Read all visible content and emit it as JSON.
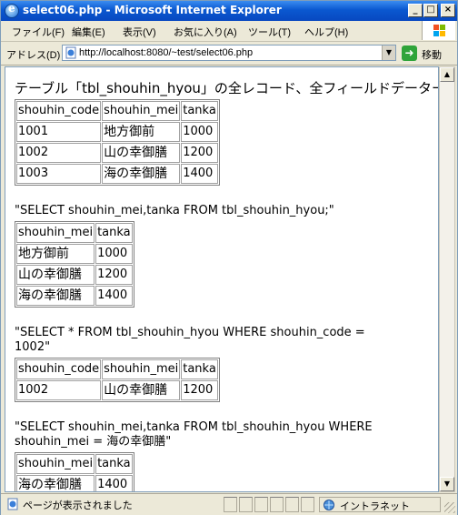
{
  "window": {
    "title": "select06.php - Microsoft Internet Explorer",
    "minimize": "_",
    "maximize": "□",
    "close": "×"
  },
  "menu": {
    "items": [
      "ファイル(F)",
      "編集(E)",
      "表示(V)",
      "お気に入り(A)",
      "ツール(T)",
      "ヘルプ(H)"
    ]
  },
  "address": {
    "label": "アドレス(D)",
    "url": "http://localhost:8080/~test/select06.php",
    "go_label": "移動"
  },
  "page": {
    "heading": "テーブル「tbl_shouhin_hyou」の全レコード、全フィールドデーター覧",
    "table1": {
      "headers": [
        "shouhin_code",
        "shouhin_mei",
        "tanka"
      ],
      "rows": [
        [
          "1001",
          "地方御前",
          "1000"
        ],
        [
          "1002",
          "山の幸御膳",
          "1200"
        ],
        [
          "1003",
          "海の幸御膳",
          "1400"
        ]
      ]
    },
    "query2": "\"SELECT shouhin_mei,tanka FROM tbl_shouhin_hyou;\"",
    "table2": {
      "headers": [
        "shouhin_mei",
        "tanka"
      ],
      "rows": [
        [
          "地方御前",
          "1000"
        ],
        [
          "山の幸御膳",
          "1200"
        ],
        [
          "海の幸御膳",
          "1400"
        ]
      ]
    },
    "query3": "\"SELECT * FROM tbl_shouhin_hyou WHERE shouhin_code = 1002\"",
    "table3": {
      "headers": [
        "shouhin_code",
        "shouhin_mei",
        "tanka"
      ],
      "rows": [
        [
          "1002",
          "山の幸御膳",
          "1200"
        ]
      ]
    },
    "query4": "\"SELECT shouhin_mei,tanka FROM tbl_shouhin_hyou WHERE shouhin_mei = 海の幸御膳\"",
    "table4": {
      "headers": [
        "shouhin_mei",
        "tanka"
      ],
      "rows": [
        [
          "海の幸御膳",
          "1400"
        ]
      ]
    }
  },
  "status": {
    "text": "ページが表示されました",
    "zone": "イントラネット"
  }
}
